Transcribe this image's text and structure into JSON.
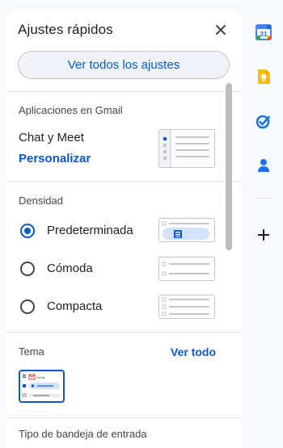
{
  "panel": {
    "title": "Ajustes rápidos",
    "all_settings_button": "Ver todos los ajustes"
  },
  "apps_section": {
    "label": "Aplicaciones en Gmail",
    "app_name": "Chat y Meet",
    "customize_link": "Personalizar"
  },
  "density_section": {
    "label": "Densidad",
    "options": [
      {
        "label": "Predeterminada",
        "selected": true
      },
      {
        "label": "Cómoda",
        "selected": false
      },
      {
        "label": "Compacta",
        "selected": false
      }
    ]
  },
  "theme_section": {
    "label": "Tema",
    "view_all_link": "Ver todo",
    "thumbnail_brand": "Gmail"
  },
  "inbox_section": {
    "label": "Tipo de bandeja de entrada"
  },
  "side_rail": {
    "calendar_day": "31",
    "icons": [
      "calendar-icon",
      "keep-icon",
      "tasks-icon",
      "contacts-icon",
      "plus-icon"
    ]
  },
  "colors": {
    "accent": "#0b57d0",
    "button_bg": "#f0f4f9",
    "app_bg": "#f8fafd",
    "divider": "#e3e3e3",
    "keep_yellow": "#fbbc04",
    "selected_thumb_bg": "#d3e3fd"
  }
}
